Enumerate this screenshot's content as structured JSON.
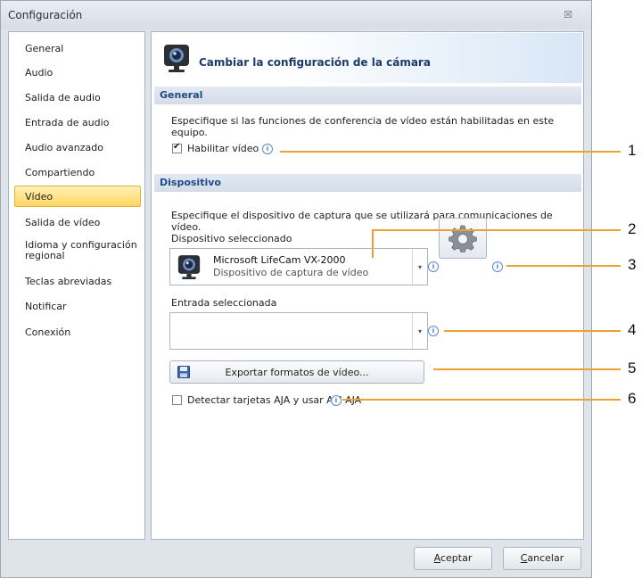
{
  "window": {
    "title": "Configuración",
    "close_glyph": "☒"
  },
  "sidebar": {
    "items": [
      {
        "label": "General"
      },
      {
        "label": "Audio"
      },
      {
        "label": "Salida de audio"
      },
      {
        "label": "Entrada de audio"
      },
      {
        "label": "Audio avanzado"
      },
      {
        "label": "Compartiendo"
      },
      {
        "label": "Vídeo",
        "selected": true
      },
      {
        "label": "Salida de vídeo"
      },
      {
        "label": "Idioma y configuración regional"
      },
      {
        "label": "Teclas abreviadas"
      },
      {
        "label": "Notificar"
      },
      {
        "label": "Conexión"
      }
    ]
  },
  "header": {
    "title": "Cambiar la configuración de la cámara",
    "icon": "webcam-icon"
  },
  "general_section": {
    "title": "General",
    "description_line1": "Especifique si las funciones de conferencia de vídeo están habilitadas en este",
    "description_line2": "equipo.",
    "enable_video_label": "Habilitar vídeo",
    "enable_video_checked": true
  },
  "device_section": {
    "title": "Dispositivo",
    "description": "Especifique el dispositivo de captura que se utilizará para comunicaciones de vídeo.",
    "selected_device_label": "Dispositivo seleccionado",
    "device_name": "Microsoft LifeCam VX-2000",
    "device_type": "Dispositivo de captura de vídeo",
    "selected_input_label": "Entrada seleccionada",
    "selected_input_value": "",
    "export_button_label": "Exportar formatos de vídeo...",
    "aja_label": "Detectar tarjetas AJA y usar API AJA",
    "aja_checked": false
  },
  "footer": {
    "accept_first": "A",
    "accept_rest": "ceptar",
    "cancel_first": "C",
    "cancel_rest": "ancelar"
  },
  "info_glyph": "i",
  "dropdown_glyph": "▾",
  "callouts": [
    "1",
    "2",
    "3",
    "4",
    "5",
    "6"
  ],
  "colors": {
    "accent": "#f0a030",
    "selected_nav": "#ffd560",
    "section_title": "#1e4a8a"
  }
}
